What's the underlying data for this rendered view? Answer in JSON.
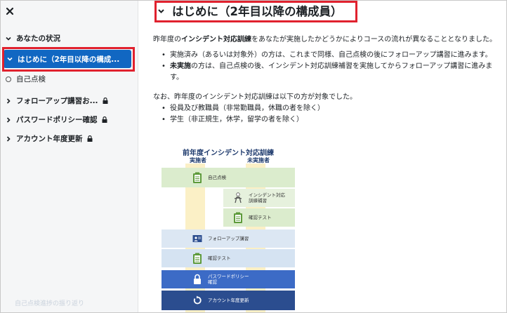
{
  "sidebar": {
    "items": [
      {
        "label": "あなたの状況"
      },
      {
        "label": "はじめに（2年目以降の構成..."
      },
      {
        "label": "自己点検"
      },
      {
        "label": "フォローアップ講習お..."
      },
      {
        "label": "パスワードポリシー確認"
      },
      {
        "label": "アカウント年度更新"
      }
    ],
    "footer": "自己点検進捗の振り返り"
  },
  "main": {
    "title": "はじめに（2年目以降の構成員）",
    "intro_prefix": "昨年度の",
    "intro_bold": "インシデント対応訓練",
    "intro_suffix": "をあなたが実施したかどうかによりコースの流れが異なることとなりました。",
    "bullet1": "実施済み（あるいは対象外）の方は、これまで同様、自己点検の後にフォローアップ講習に進みます。",
    "bullet2_bold": "未実施",
    "bullet2_rest": "の方は、自己点検の後、インシデント対応訓練補習を実施してからフォローアップ講習に進みます。",
    "note": "なお、昨年度のインシデント対応訓練は以下の方が対象でした。",
    "targets": [
      "役員及び教職員（非常勤職員，休職の者を除く）",
      "学生（非正規生，休学，留学の者を除く）"
    ]
  },
  "diagram": {
    "title": "前年度インシデント対応訓練",
    "col_done": "実施者",
    "col_notdone": "未実施者",
    "steps": {
      "self_check": "自己点検",
      "incident_makeup": "インシデント対応\n訓練補習",
      "confirm_test_1": "確認テスト",
      "followup": "フォローアップ講習",
      "confirm_test_2": "確認テスト",
      "password": "パスワードポリシー\n確認",
      "account": "アカウント年度更新"
    }
  },
  "colors": {
    "accent": "#1167c2",
    "highlight": "#e0212e"
  }
}
